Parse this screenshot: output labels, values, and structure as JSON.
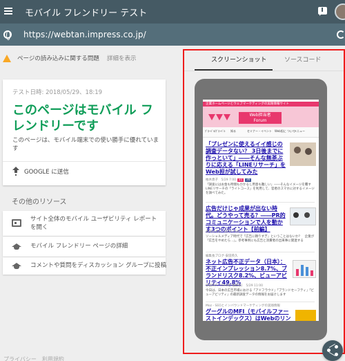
{
  "appbar": {
    "title": "モバイル フレンドリー テスト"
  },
  "urlbar": {
    "url": "https://webtan.impress.co.jp/"
  },
  "warning": {
    "text": "ページの読み込みに関する問題",
    "link": "詳細を表示"
  },
  "result": {
    "test_date": "テスト日時: 2018/05/29、18:19",
    "title": "このページはモバイル フレンドリーです",
    "description": "このページは、モバイル端末での使い勝手に優れています",
    "send_label": "GOOGLE に送信"
  },
  "resources": {
    "heading": "その他のリソース",
    "items": [
      {
        "label": "サイト全体のモバイル ユーザビリティ レポートを開く",
        "icon": "browser-window-icon"
      },
      {
        "label": "モバイル フレンドリー ページの詳細",
        "icon": "school-cap-icon"
      },
      {
        "label": "コメントや質問をディスカッション グループに投稿",
        "icon": "school-cap-icon"
      }
    ]
  },
  "bottom_faint": "プライバシー　利用規約",
  "tabs": {
    "screenshot": "スクリーンショット",
    "source": "ソースコード"
  },
  "preview": {
    "strip": "企業ホームページとウェブマーケティングの実践情報サイト",
    "logo_text_1": "Web担当者",
    "logo_text_2": "Forum",
    "nav": [
      "ｸﾞﾛｰﾊﾞﾙ/ｸﾞﾛｰﾊﾞﾙ",
      "知る",
      "セミナー・イベント",
      "Web担に\nついて",
      "メニュー"
    ],
    "articles": [
      {
        "title": "「プレゼンに使えるイイ感じの調査データない？ 3日後までに作っといて」――そんな無茶ぶりに応える「LINEリサーチ」をWeb担が試してみた",
        "meta": "柏木恵子　5/29 7:00",
        "body": "「調査にはお金も時間もかかるし用意も難しい」――そんなイメージを覆すLINEリサーチの「ライトコース」を利用して、官者のスマホに対するイメージを調べてみた。"
      },
      {
        "title": "広告だけじゃ成果が出ない時代。どうやって売る？――PR的コミュニケーションで人を動かす3つのポイント【前編】",
        "meta": "本多いずみ　5/29 7:00",
        "body": "ソーシャルメディア時代で「広告に頼りすぎ」ということはないか？　企業が「広告をやめたら…」。参考事例にも広告と消費者の出来事に関連する"
      },
      {
        "cat": "編集長ブログ-安田英久",
        "title": "ネット広告不正データ（日本）：不正インプレッション8.7%、ブランドリスク8.2%、ビューアビリティ49.8%",
        "meta": "安田英久（Web担 編集長）　5/29 11:00",
        "body": "今日は、日本の広告市場における「アドフラウド」「ブランドセーフティ」「ビューアビリティ」の最新調査データの情報をお届けします"
      },
      {
        "cat": "Moz - SEOとインバウンドマーケティングの実践情報",
        "title": "グーグルのMFI（モバイルファーストインデックス）はWebのリンク構造に激変を",
        "meta": "",
        "body": ""
      }
    ],
    "article_badges": [
      "31",
      "36"
    ]
  },
  "colors": {
    "appbar": "#455a64",
    "urlbar": "#546e7a",
    "success_green": "#0f9d58",
    "highlight_border": "#ee1c1c",
    "link_blue": "#1a0dab",
    "brand_pink": "#e8376d"
  }
}
